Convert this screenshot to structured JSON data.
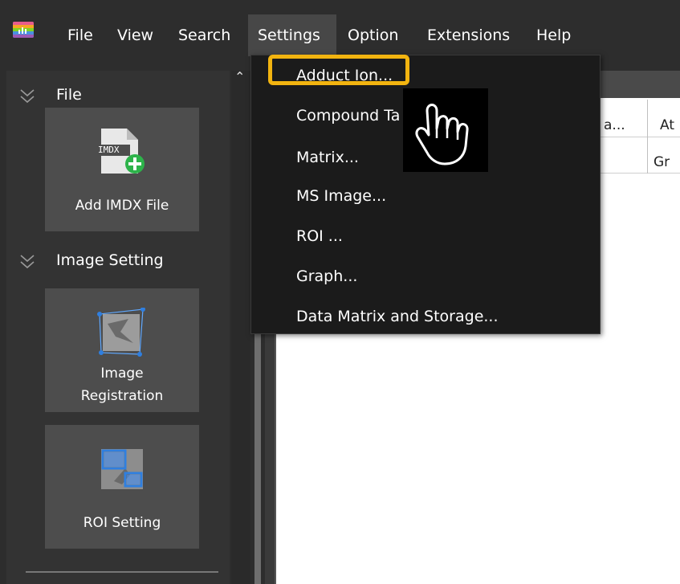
{
  "menubar": {
    "items": [
      "File",
      "View",
      "Search",
      "Settings",
      "Option",
      "Extensions",
      "Help"
    ],
    "active": "Settings"
  },
  "sidebar": {
    "sections": [
      {
        "title": "File"
      },
      {
        "title": "Image Setting"
      }
    ],
    "tiles": [
      {
        "label_lines": [
          "Add IMDX File"
        ],
        "icon_text": "IMDX"
      },
      {
        "label_lines": [
          "Image",
          "Registration"
        ]
      },
      {
        "label_lines": [
          "ROI Setting"
        ]
      }
    ]
  },
  "table": {
    "header_partial": [
      "a...",
      "At"
    ],
    "row_partial": [
      "Gr"
    ]
  },
  "settings_menu": {
    "items": [
      "Adduct Ion...",
      "Compound Ta",
      "Matrix...",
      "MS Image...",
      "ROI ...",
      "Graph...",
      "Data Matrix and Storage..."
    ]
  },
  "colors": {
    "highlight": "#f2b410",
    "menu_bg": "#1b1b1b",
    "accent_plus": "#2db34a",
    "accent_blue": "#2f7fe0"
  }
}
